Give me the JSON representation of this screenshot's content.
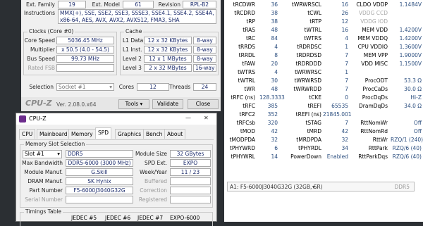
{
  "cpu": {
    "ext_family_label": "Ext. Family",
    "ext_family": "19",
    "ext_model_label": "Ext. Model",
    "ext_model": "61",
    "revision_label": "Revision",
    "revision": "RPL-B2",
    "instructions_label": "Instructions",
    "instructions_line1": "MMX(+), SSE, SSE2, SSE3, SSSE3, SSE4.1, SSE4.2, SSE4A,",
    "instructions_line2": "x86-64, AES, AVX, AVX2, AVX512, FMA3, SHA",
    "clocks_title": "Clocks (Core #0)",
    "core_speed_label": "Core Speed",
    "core_speed": "5036.45 MHz",
    "multiplier_label": "Multiplier",
    "multiplier": "x 50.5 (4.0 - 54.5)",
    "bus_speed_label": "Bus Speed",
    "bus_speed": "99.73 MHz",
    "rated_fsb_label": "Rated FSB",
    "cache_title": "Cache",
    "cache": [
      {
        "label": "L1 Data",
        "size": "12 x 32 KBytes",
        "way": "8-way"
      },
      {
        "label": "L1 Inst.",
        "size": "12 x 32 KBytes",
        "way": "8-way"
      },
      {
        "label": "Level 2",
        "size": "12 x 1 MBytes",
        "way": "8-way"
      },
      {
        "label": "Level 3",
        "size": "2 x 32 MBytes",
        "way": "16-way"
      }
    ],
    "selection_label": "Selection",
    "selection_value": "Socket #1",
    "cores_label": "Cores",
    "cores": "12",
    "threads_label": "Threads",
    "threads": "24"
  },
  "footer1": {
    "brand": "CPU-Z",
    "version": "Ver. 2.08.0.x64",
    "tools": "Tools",
    "validate": "Validate",
    "close": "Close"
  },
  "win2": {
    "title": "CPU-Z",
    "minimize": "—",
    "close": "✕",
    "tabs": [
      "CPU",
      "Mainboard",
      "Memory",
      "SPD",
      "Graphics",
      "Bench",
      "About"
    ],
    "active_tab": "SPD",
    "slot_group_title": "Memory Slot Selection",
    "slot_value": "Slot #1",
    "ddr_type": "DDR5",
    "module_size_label": "Module Size",
    "module_size": "32 GBytes",
    "max_bw_label": "Max Bandwidth",
    "max_bw": "DDR5-6000 (3000 MHz)",
    "spd_ext_label": "SPD Ext.",
    "spd_ext": "EXPO",
    "module_manuf_label": "Module Manuf.",
    "module_manuf": "G.Skill",
    "week_year_label": "Week/Year",
    "week_year": "11 / 23",
    "dram_manuf_label": "DRAM Manuf.",
    "dram_manuf": "SK Hynix",
    "buffered_label": "Buffered",
    "part_number_label": "Part Number",
    "part_number": "F5-6000J3040G32G",
    "correction_label": "Correction",
    "serial_label": "Serial Number",
    "registered_label": "Registered",
    "timings_title": "Timings Table",
    "timing_headers": [
      "JEDEC #5",
      "JEDEC #6",
      "JEDEC #7",
      "EXPO-6000"
    ]
  },
  "timings": [
    {
      "l1": "tRCDWR",
      "v1": "36",
      "l2": "tWRWRSCL",
      "v2": "16",
      "l3": "CLDO VDDP",
      "v3": "1.1484V"
    },
    {
      "l1": "tRCDRD",
      "v1": "38",
      "l2": "tCWL",
      "v2": "26",
      "l3": "VDDG CCD",
      "v3": ""
    },
    {
      "l1": "tRP",
      "v1": "38",
      "l2": "tRTP",
      "v2": "12",
      "l3": "VDDG IOD",
      "v3": ""
    },
    {
      "l1": "tRAS",
      "v1": "48",
      "l2": "tWTRL",
      "v2": "16",
      "l3": "MEM VDD",
      "v3": "1.4200V"
    },
    {
      "l1": "tRC",
      "v1": "84",
      "l2": "tWTRS",
      "v2": "4",
      "l3": "MEM VDDQ",
      "v3": "1.4200V"
    },
    {
      "l1": "tRRDS",
      "v1": "4",
      "l2": "tRDRDSC",
      "v2": "1",
      "l3": "CPU VDDIO",
      "v3": "1.3600V"
    },
    {
      "l1": "tRRDL",
      "v1": "8",
      "l2": "tRDRDSD",
      "v2": "7",
      "l3": "MEM VPP",
      "v3": "1.9000V"
    },
    {
      "l1": "tFAW",
      "v1": "20",
      "l2": "tRDRDDD",
      "v2": "7",
      "l3": "VDD MISC",
      "v3": "1.1500V"
    },
    {
      "l1": "tWTRS",
      "v1": "4",
      "l2": "tWRWRSC",
      "v2": "1",
      "l3": "",
      "v3": ""
    },
    {
      "l1": "tWTRL",
      "v1": "30",
      "l2": "tWRWRSD",
      "v2": "7",
      "l3": "ProcODT",
      "v3": "53.3 Ω"
    },
    {
      "l1": "tWR",
      "v1": "48",
      "l2": "tWRWRDD",
      "v2": "7",
      "l3": "ProcCaDs",
      "v3": "30.0 Ω"
    },
    {
      "l1": "tRFC (ns)",
      "v1": "128.3333",
      "l2": "tCKE",
      "v2": "0",
      "l3": "ProcDqDs",
      "v3": "Hi-Z"
    },
    {
      "l1": "tRFC",
      "v1": "385",
      "l2": "tREFI",
      "v2": "65535",
      "l3": "DramDqDs",
      "v3": "34.0 Ω"
    },
    {
      "l1": "tRFC2",
      "v1": "352",
      "l2": "tREFI (ns)",
      "v2": "21845.001",
      "l3": "",
      "v3": ""
    },
    {
      "l1": "tRFCsb",
      "v1": "320",
      "l2": "tSTAG",
      "v2": "7",
      "l3": "RttNomWr",
      "v3": "Off"
    },
    {
      "l1": "tMOD",
      "v1": "42",
      "l2": "tMRD",
      "v2": "42",
      "l3": "RttNomRd",
      "v3": "Off"
    },
    {
      "l1": "tMODPDA",
      "v1": "32",
      "l2": "tMRDPDA",
      "v2": "32",
      "l3": "RttWr",
      "v3": "RZQ/1 (240)"
    },
    {
      "l1": "tPHYWRD",
      "v1": "6",
      "l2": "tPHYRDL",
      "v2": "34",
      "l3": "RttPark",
      "v3": "RZQ/6 (40)"
    },
    {
      "l1": "tPHYWRL",
      "v1": "14",
      "l2": "PowerDown",
      "v2": "Enabled",
      "l3": "RttParkDqs",
      "v3": "RZQ/6 (40)"
    }
  ],
  "dimm_select": {
    "value": "A1: F5-6000J3040G32G (32GB, SR)",
    "type": "DDR5"
  }
}
